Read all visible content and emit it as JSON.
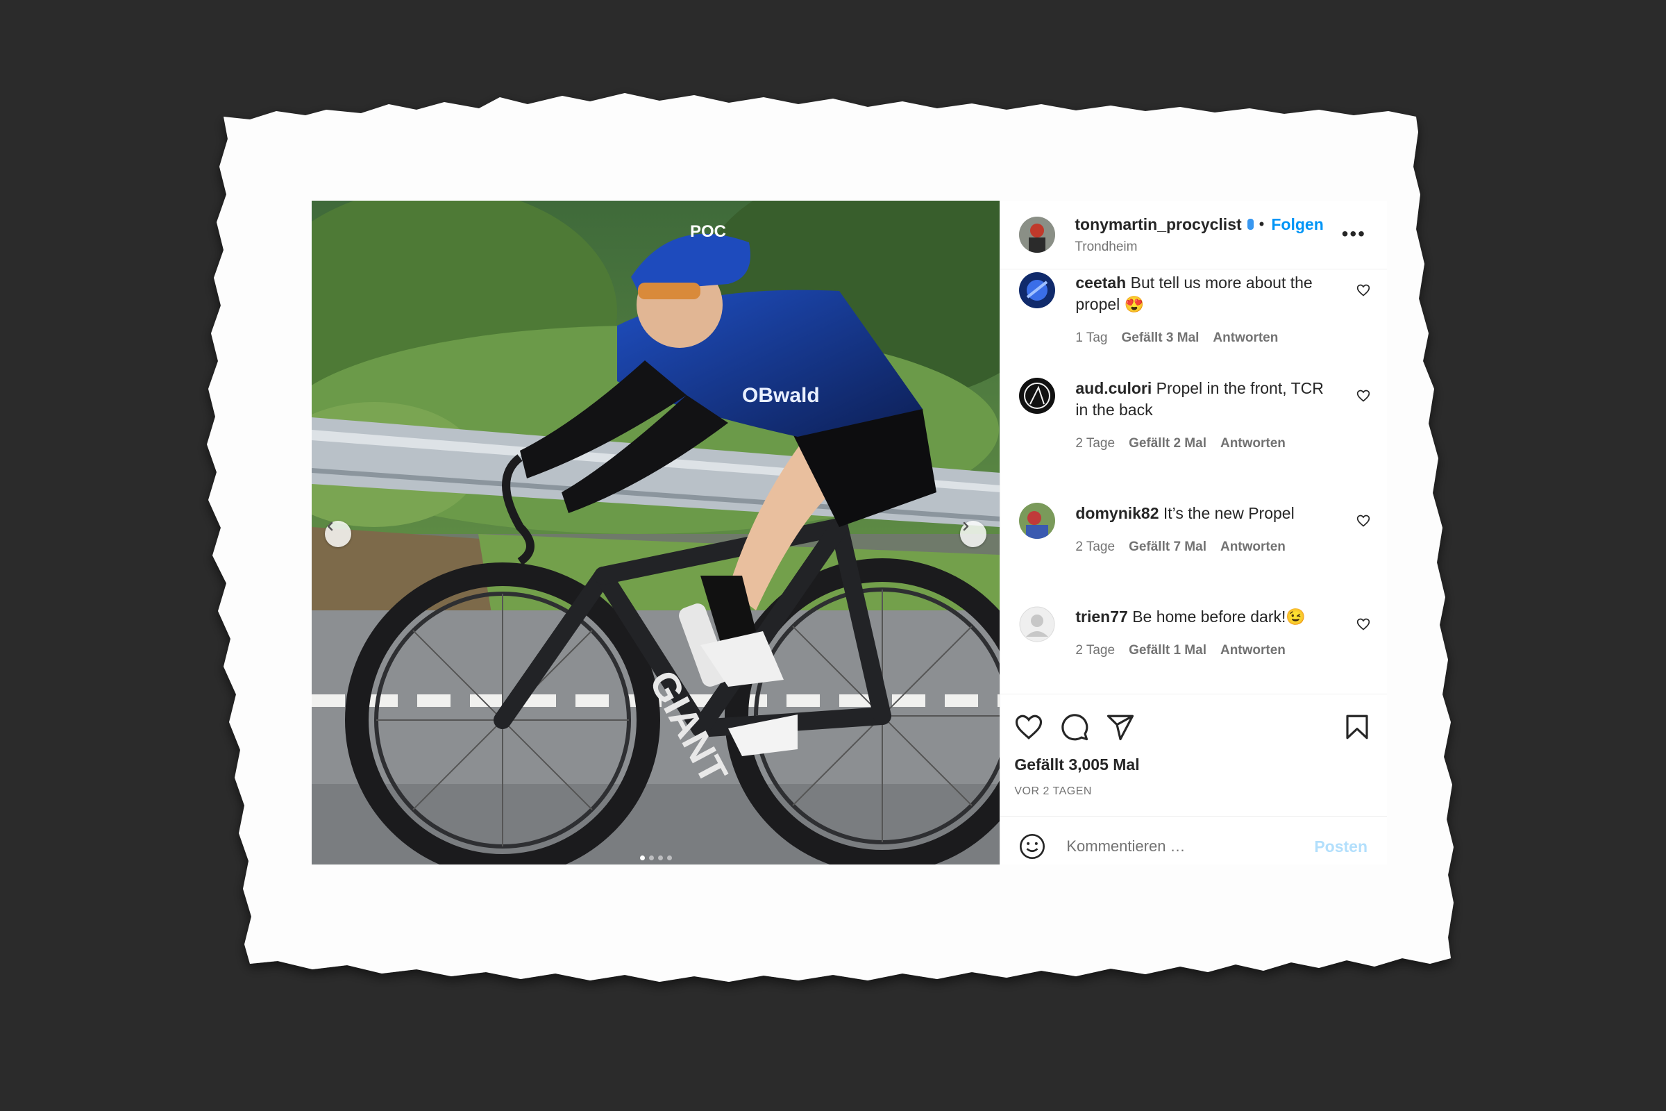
{
  "post": {
    "author": {
      "username": "tonymartin_procyclist",
      "location": "Trondheim",
      "follow_label": "Folgen",
      "separator": "•",
      "more_label": "•••"
    },
    "photo": {
      "jersey_text": "OBwald",
      "bike_text": "GIANT",
      "helmet_text": "POC",
      "carousel_count": 4,
      "carousel_active": 1
    },
    "comments": [
      {
        "username": "ceetah",
        "text": "But tell us more about the propel 😍",
        "age": "1 Tag",
        "likes": "Gefällt 3 Mal",
        "reply": "Antworten"
      },
      {
        "username": "aud.culori",
        "text": "Propel in the front, TCR in the back",
        "age": "2 Tage",
        "likes": "Gefällt 2 Mal",
        "reply": "Antworten"
      },
      {
        "username": "domynik82",
        "text": "It’s the new Propel",
        "age": "2 Tage",
        "likes": "Gefällt 7 Mal",
        "reply": "Antworten"
      },
      {
        "username": "trien77",
        "text": "Be home before dark!😉",
        "age": "2 Tage",
        "likes": "Gefällt 1 Mal",
        "reply": "Antworten"
      }
    ],
    "likes_label": "Gefällt 3,005 Mal",
    "timestamp": "VOR 2 TAGEN",
    "composer": {
      "placeholder": "Kommentieren …",
      "post_label": "Posten"
    }
  },
  "colors": {
    "background": "#2b2b2b",
    "paper": "#ffffff",
    "link_blue": "#0095f6",
    "post_button_disabled": "#b2dffc",
    "secondary_text": "#737373",
    "primary_text": "#262626"
  },
  "icons": [
    "chevron-left-icon",
    "chevron-right-icon",
    "verified-badge-icon",
    "more-icon",
    "heart-icon",
    "comment-icon",
    "share-icon",
    "bookmark-icon",
    "emoji-icon"
  ]
}
